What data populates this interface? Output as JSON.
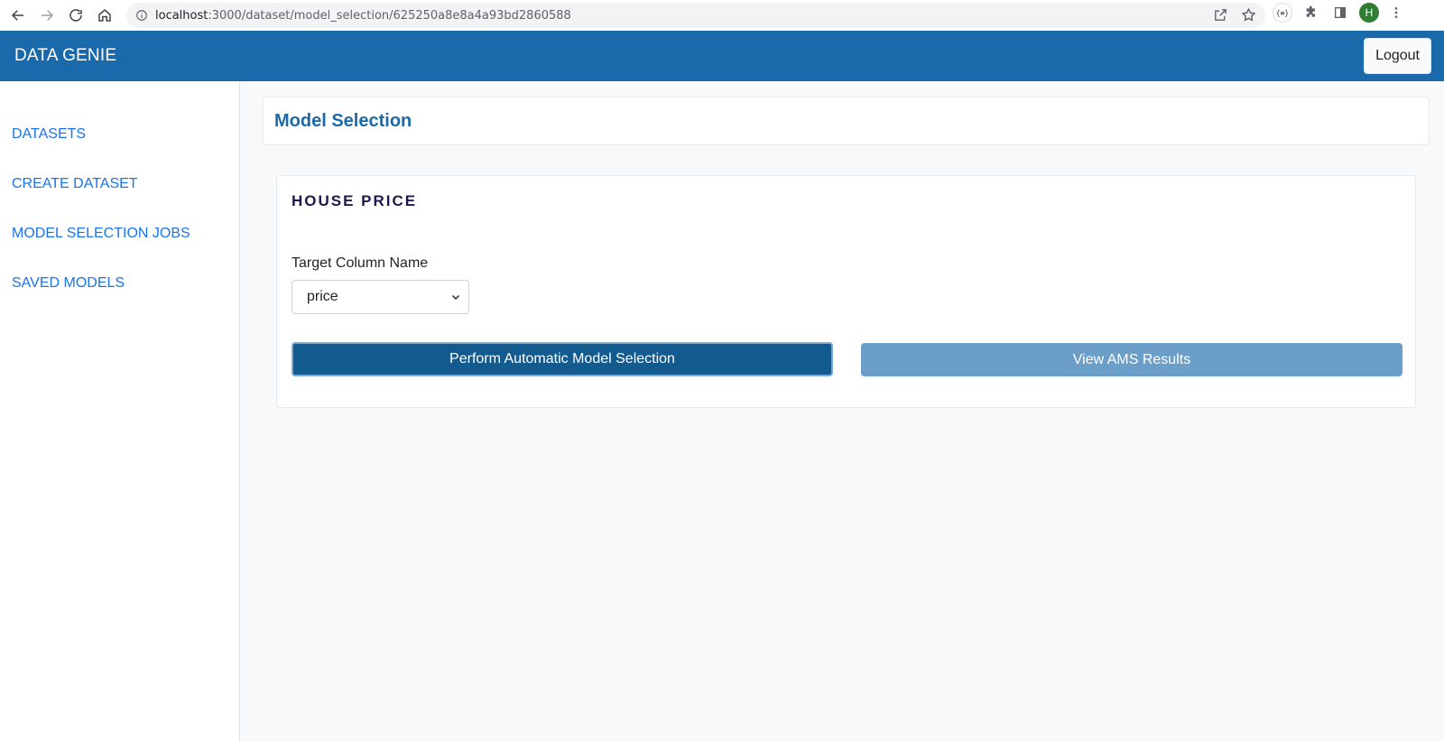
{
  "browser": {
    "url_host": "localhost",
    "url_path": ":3000/dataset/model_selection/625250a8e8a4a93bd2860588",
    "profile_initial": "H",
    "extension_badge": "{≡}"
  },
  "header": {
    "brand": "DATA GENIE",
    "logout_label": "Logout",
    "color": "#1a6aab"
  },
  "sidebar": {
    "items": [
      {
        "label": "DATASETS"
      },
      {
        "label": "CREATE DATASET"
      },
      {
        "label": "MODEL SELECTION JOBS"
      },
      {
        "label": "SAVED MODELS"
      }
    ]
  },
  "main": {
    "title": "Model Selection",
    "dataset": {
      "name": "HOUSE PRICE",
      "target_label": "Target Column Name",
      "target_value": "price",
      "perform_label": "Perform Automatic Model Selection",
      "view_label": "View AMS Results"
    }
  }
}
